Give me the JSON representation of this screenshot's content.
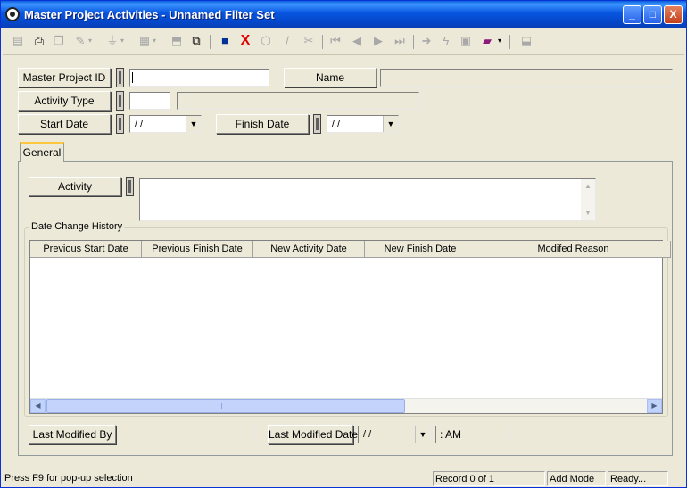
{
  "window": {
    "title": "Master Project Activities - Unnamed Filter Set"
  },
  "titlebar": {
    "minimize": "_",
    "maximize": "□",
    "close": "X"
  },
  "toolbar": {
    "icons": [
      "print-preview-icon",
      "print-icon",
      "copy-icon",
      "wand-icon",
      "filter-icon",
      "report-icon",
      "export-icon",
      "duplicate-icon",
      "save-icon",
      "delete-icon",
      "stamp-icon",
      "edit-icon",
      "cut-icon",
      "first-record-icon",
      "previous-record-icon",
      "next-record-icon",
      "last-record-icon",
      "jump-icon",
      "lightning-icon",
      "grid-icon",
      "book-icon",
      "settings-icon"
    ],
    "delete_glyph": "X"
  },
  "form": {
    "master_project_id_label": "Master Project ID",
    "master_project_id_value": "",
    "name_label": "Name",
    "name_value": "",
    "activity_type_label": "Activity Type",
    "activity_type_code": "",
    "activity_type_desc": "",
    "start_date_label": "Start Date",
    "start_date_value": " /  /",
    "finish_date_label": "Finish Date",
    "finish_date_value": " /  /"
  },
  "tabs": [
    {
      "label": "General"
    }
  ],
  "general": {
    "activity_label": "Activity",
    "activity_value": "",
    "history_group_label": "Date Change History",
    "columns": [
      "Previous Start Date",
      "Previous Finish Date",
      "New Activity Date",
      "New Finish Date",
      "Modifed Reason"
    ],
    "rows": []
  },
  "footer": {
    "last_modified_by_label": "Last Modified By",
    "last_modified_by_value": "",
    "last_modified_date_label": "Last Modified Date",
    "last_modified_date_value": " /  /",
    "last_modified_time_value": " :  AM"
  },
  "status": {
    "hint": "Press F9 for pop-up selection",
    "record": "Record 0 of 1",
    "mode": "Add Mode",
    "state": "Ready..."
  }
}
